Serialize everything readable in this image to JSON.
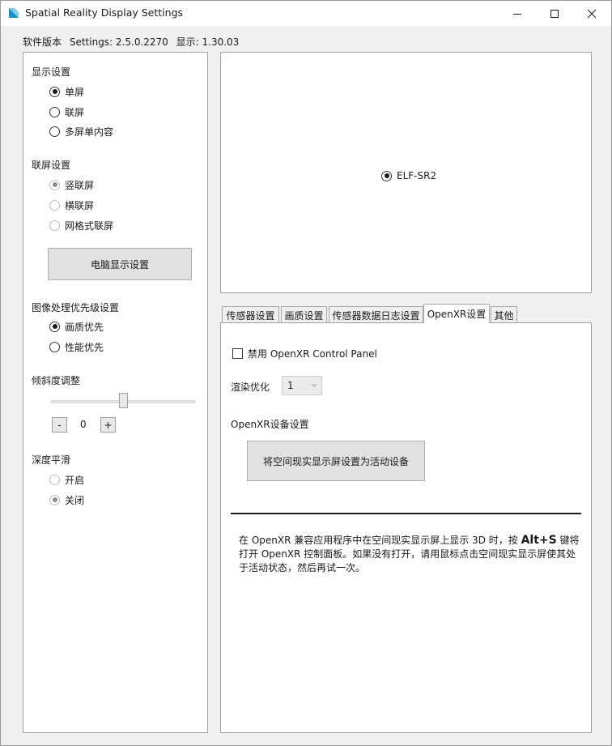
{
  "window": {
    "title": "Spatial Reality Display Settings",
    "accent_color": "#1b8fc9"
  },
  "version": {
    "label": "软件版本",
    "settings": "Settings: 2.5.0.2270",
    "display": "显示: 1.30.03"
  },
  "display_settings": {
    "label": "显示设置",
    "options": [
      {
        "label": "单屏",
        "checked": true
      },
      {
        "label": "联屏",
        "checked": false
      },
      {
        "label": "多屏单内容",
        "checked": false
      }
    ]
  },
  "tiled_settings": {
    "label": "联屏设置",
    "options": [
      {
        "label": "竖联屏",
        "checked": true,
        "disabled": true
      },
      {
        "label": "横联屏",
        "checked": false,
        "disabled": true
      },
      {
        "label": "网格式联屏",
        "checked": false,
        "disabled": true
      }
    ],
    "button_label": "电脑显示设置"
  },
  "image_priority": {
    "label": "图像处理优先级设置",
    "options": [
      {
        "label": "画质优先",
        "checked": true
      },
      {
        "label": "性能优先",
        "checked": false
      }
    ]
  },
  "tilt": {
    "label": "倾斜度调整",
    "minus": "-",
    "plus": "+",
    "value": "0"
  },
  "depth_smoothing": {
    "label": "深度平滑",
    "options": [
      {
        "label": "开启",
        "checked": false,
        "disabled": true
      },
      {
        "label": "关闭",
        "checked": true,
        "disabled": true
      }
    ]
  },
  "devices": [
    {
      "label": "ELF-SR2",
      "checked": true
    }
  ],
  "tabs": [
    {
      "label": "传感器设置",
      "active": false
    },
    {
      "label": "画质设置",
      "active": false
    },
    {
      "label": "传感器数据日志设置",
      "active": false
    },
    {
      "label": "OpenXR设置",
      "active": true
    },
    {
      "label": "其他",
      "active": false
    }
  ],
  "openxr": {
    "disable_panel_label": "禁用 OpenXR Control Panel",
    "disable_panel_checked": false,
    "render_opt_label": "渲染优化",
    "render_opt_value": "1",
    "device_settings_label": "OpenXR设备设置",
    "set_active_button": "将空间现实显示屏设置为活动设备",
    "info_part1": "在 OpenXR 兼容应用程序中在空间现实显示屏上显示 3D 时，按 ",
    "info_shortcut": "Alt+S",
    "info_part2": " 键将打开 OpenXR 控制面板。如果没有打开，请用鼠标点击空间现实显示屏使其处于活动状态，然后再试一次。"
  }
}
